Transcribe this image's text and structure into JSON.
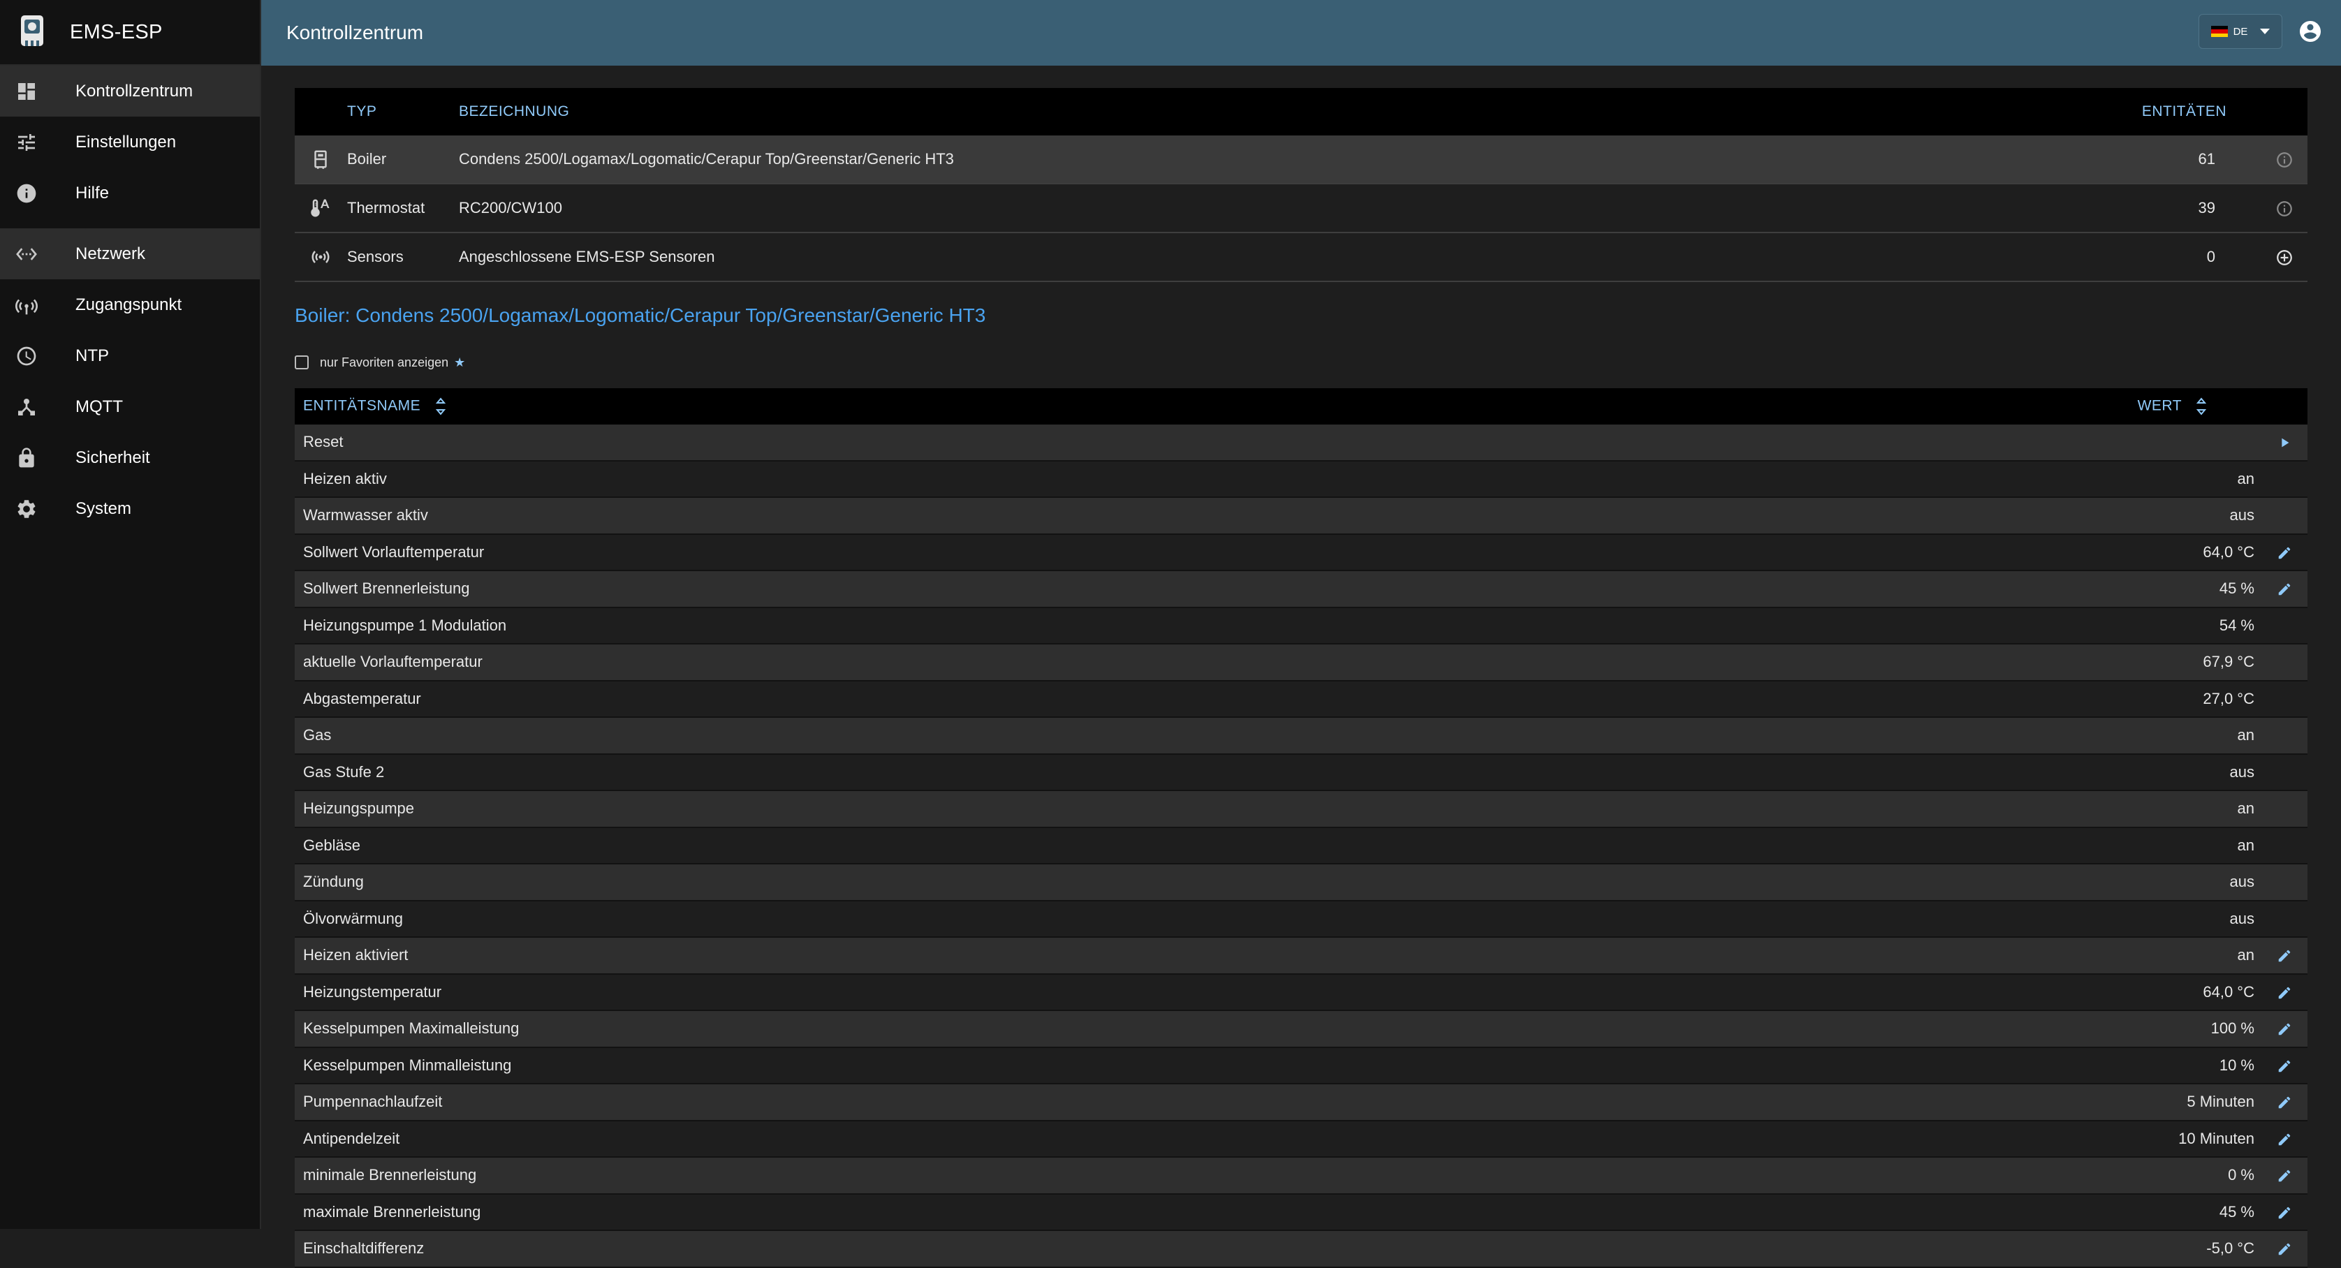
{
  "app": {
    "name": "EMS-ESP",
    "page_title": "Kontrollzentrum",
    "language": "DE"
  },
  "colors": {
    "appbar": "#3a5f74",
    "accent": "#90caf9",
    "title_link": "#4aa3f0"
  },
  "sidebar": {
    "items": [
      {
        "label": "Kontrollzentrum",
        "icon": "dashboard-icon",
        "active": true
      },
      {
        "label": "Einstellungen",
        "icon": "tune-icon"
      },
      {
        "label": "Hilfe",
        "icon": "info-icon"
      },
      {
        "label": "Netzwerk",
        "icon": "settings-ethernet-icon",
        "active": true
      },
      {
        "label": "Zugangspunkt",
        "icon": "access-point-icon"
      },
      {
        "label": "NTP",
        "icon": "clock-icon"
      },
      {
        "label": "MQTT",
        "icon": "device-hub-icon"
      },
      {
        "label": "Sicherheit",
        "icon": "lock-icon"
      },
      {
        "label": "System",
        "icon": "gear-icon"
      }
    ]
  },
  "devices": {
    "headers": {
      "type": "TYP",
      "name": "BEZEICHNUNG",
      "entities": "ENTITÄTEN"
    },
    "rows": [
      {
        "type": "Boiler",
        "name": "Condens 2500/Logamax/Logomatic/Cerapur Top/Greenstar/Generic HT3",
        "entities": "61",
        "icon": "boiler-icon",
        "action": "info-icon"
      },
      {
        "type": "Thermostat",
        "name": "RC200/CW100",
        "entities": "39",
        "icon": "thermostat-icon",
        "action": "info-icon"
      },
      {
        "type": "Sensors",
        "name": "Angeschlossene EMS-ESP Sensoren",
        "entities": "0",
        "icon": "sensors-icon",
        "action": "add-circle-icon"
      }
    ]
  },
  "selected_device": {
    "title": "Boiler: Condens 2500/Logamax/Logomatic/Cerapur Top/Greenstar/Generic HT3",
    "favorites_label": "nur Favoriten anzeigen",
    "favorites_checked": false
  },
  "entities": {
    "headers": {
      "name": "ENTITÄTSNAME",
      "value": "WERT"
    },
    "rows": [
      {
        "name": "Reset",
        "value": "",
        "action": "play"
      },
      {
        "name": "Heizen aktiv",
        "value": "an",
        "action": ""
      },
      {
        "name": "Warmwasser aktiv",
        "value": "aus",
        "action": ""
      },
      {
        "name": "Sollwert Vorlauftemperatur",
        "value": "64,0 °C",
        "action": "edit"
      },
      {
        "name": "Sollwert Brennerleistung",
        "value": "45 %",
        "action": "edit"
      },
      {
        "name": "Heizungspumpe 1 Modulation",
        "value": "54 %",
        "action": ""
      },
      {
        "name": "aktuelle Vorlauftemperatur",
        "value": "67,9 °C",
        "action": ""
      },
      {
        "name": "Abgastemperatur",
        "value": "27,0 °C",
        "action": ""
      },
      {
        "name": "Gas",
        "value": "an",
        "action": ""
      },
      {
        "name": "Gas Stufe 2",
        "value": "aus",
        "action": ""
      },
      {
        "name": "Heizungspumpe",
        "value": "an",
        "action": ""
      },
      {
        "name": "Gebläse",
        "value": "an",
        "action": ""
      },
      {
        "name": "Zündung",
        "value": "aus",
        "action": ""
      },
      {
        "name": "Ölvorwärmung",
        "value": "aus",
        "action": ""
      },
      {
        "name": "Heizen aktiviert",
        "value": "an",
        "action": "edit"
      },
      {
        "name": "Heizungstemperatur",
        "value": "64,0 °C",
        "action": "edit"
      },
      {
        "name": "Kesselpumpen Maximalleistung",
        "value": "100 %",
        "action": "edit"
      },
      {
        "name": "Kesselpumpen Minmalleistung",
        "value": "10 %",
        "action": "edit"
      },
      {
        "name": "Pumpennachlaufzeit",
        "value": "5 Minuten",
        "action": "edit"
      },
      {
        "name": "Antipendelzeit",
        "value": "10 Minuten",
        "action": "edit"
      },
      {
        "name": "minimale Brennerleistung",
        "value": "0 %",
        "action": "edit"
      },
      {
        "name": "maximale Brennerleistung",
        "value": "45 %",
        "action": "edit"
      },
      {
        "name": "Einschaltdifferenz",
        "value": "-5,0 °C",
        "action": "edit"
      }
    ]
  }
}
